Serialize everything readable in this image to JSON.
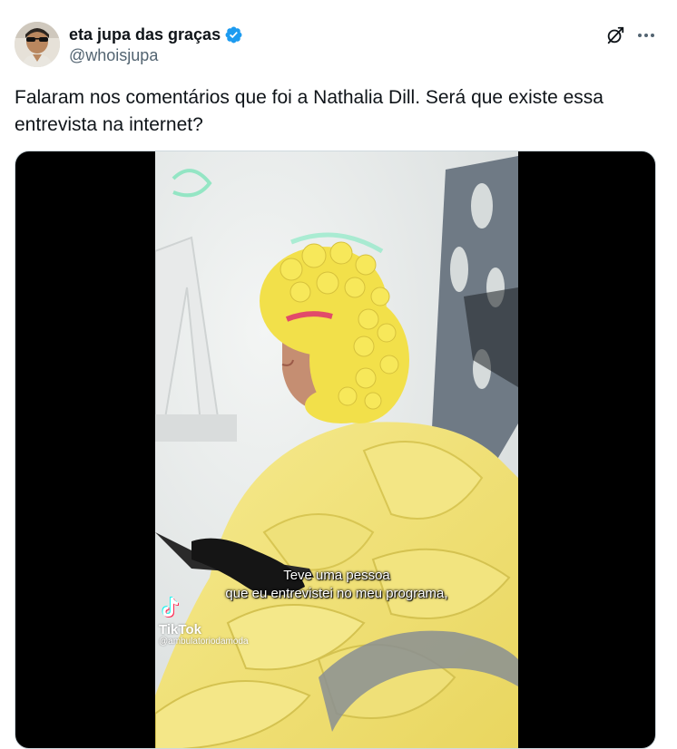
{
  "author": {
    "display_name": "eta jupa das graças",
    "handle": "@whoisjupa"
  },
  "tweet": {
    "text": "Falaram nos comentários que foi a Nathalia Dill. Será que existe essa entrevista na internet?"
  },
  "media": {
    "watermark_name": "TikTok",
    "watermark_handle": "@ambulatoriodamoda",
    "subtitle_line1": "Teve uma pessoa",
    "subtitle_line2": "que eu entrevistei no meu programa,"
  },
  "icons": {
    "verified": "verified-badge-icon",
    "grok": "grok-icon",
    "more": "more-options-icon",
    "tiktok": "tiktok-logo-icon"
  },
  "colors": {
    "verified_blue": "#1d9bf0",
    "text_primary": "#0f1419",
    "text_secondary": "#536471",
    "outfit_yellow": "#f2e27a"
  }
}
